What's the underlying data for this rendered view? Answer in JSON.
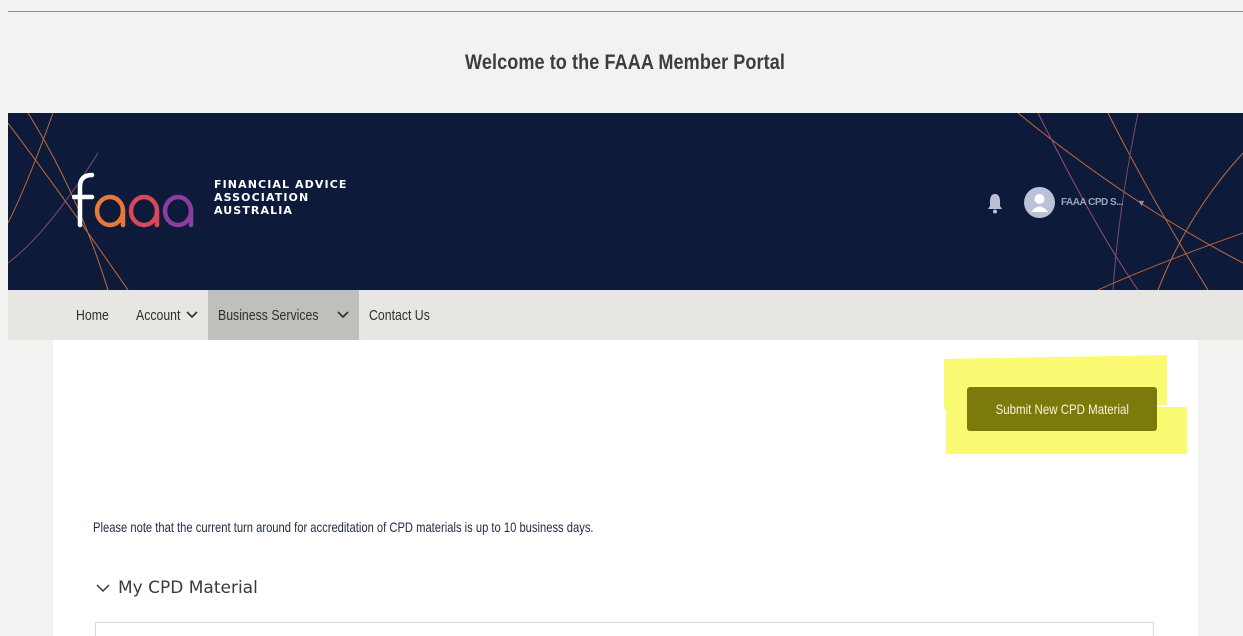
{
  "header": {
    "title": "Welcome to the FAAA Member Portal"
  },
  "brand": {
    "logo_wordmark": "faaa",
    "line1": "FINANCIAL ADVICE",
    "line2": "ASSOCIATION",
    "line3": "AUSTRALIA",
    "navy": "#0d1a3a"
  },
  "user": {
    "name": "FAAA CPD S...",
    "bell_icon": "bell-icon",
    "avatar_icon": "user-avatar-icon"
  },
  "nav": {
    "items": [
      {
        "label": "Home",
        "has_dropdown": false,
        "active": false
      },
      {
        "label": "Account",
        "has_dropdown": true,
        "active": false
      },
      {
        "label": "Business Services",
        "has_dropdown": true,
        "active": true
      },
      {
        "label": "Contact Us",
        "has_dropdown": false,
        "active": false
      }
    ]
  },
  "main": {
    "submit_button_label": "Submit New CPD Material",
    "notice": "Please note that the current turn around for accreditation of CPD materials is up to 10 business days.",
    "section_title": "My CPD Material",
    "highlight_color": "#fbfa73",
    "button_color": "#7c7a0a"
  }
}
